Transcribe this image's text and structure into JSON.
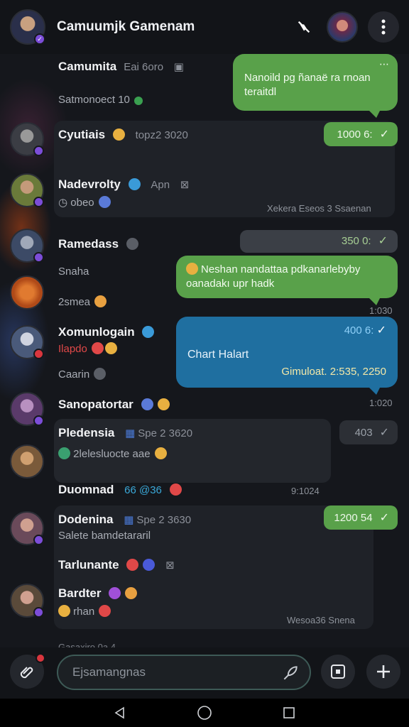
{
  "header": {
    "title": "Camuumjk Gamenam",
    "avatar_color": "#3a3f6a",
    "profile_color": "#8a3a4a"
  },
  "rows": [
    {
      "name": "Camumita",
      "meta": "Eai 6oro",
      "sub": "Satmonoect 10",
      "avatar_color": "#2b2f3a"
    },
    {
      "name": "Cyutiais",
      "meta": "topz2  3020",
      "sub": "",
      "avatar_color": "#3b3d44"
    },
    {
      "name": "Nadevrolty",
      "meta": "Apn",
      "sub": "obeo",
      "avatar_color": "#6a7a3a"
    },
    {
      "name": "Ramedass",
      "meta": "",
      "sub": "Snaha",
      "avatar_color": "#3c4a66"
    },
    {
      "name": "",
      "meta": "",
      "sub": "2smea",
      "avatar_color": "#b04a18"
    },
    {
      "name": "Xomunlogain",
      "meta": "",
      "sub": "Ilapdo",
      "sub2": "Caarin",
      "avatar_color": "#4a5a7a"
    },
    {
      "name": "Sanopatortar",
      "meta": "",
      "sub": "",
      "avatar_color": "#5a3a6a"
    },
    {
      "name": "Pledensia",
      "meta": "Spe 2  3620",
      "sub": "2lelesluocte aae",
      "avatar_color": "#7a5a3a"
    },
    {
      "name": "Duomnad",
      "meta": "66 @36",
      "sub": "",
      "avatar_color": "#3a3a3a"
    },
    {
      "name": "Dodenina",
      "meta": "Spe 2  3630",
      "sub": "Salete bamdetararil",
      "avatar_color": "#6a4a5a"
    },
    {
      "name": "Tarlunante",
      "meta": "",
      "sub": "",
      "avatar_color": "#3a3a3a"
    },
    {
      "name": "Bardter",
      "meta": "",
      "sub": "rhan",
      "avatar_color": "#5a4a3a"
    }
  ],
  "bubbles": {
    "b1": {
      "text": "Nanoild pg ñanaë ra rnoan teraitdl",
      "dots": "⋯"
    },
    "b2": {
      "text": "1000 6:",
      "check": "✓"
    },
    "b3": {
      "text": "Xekera Eseos 3  Ssaenan"
    },
    "b4": {
      "text": "350 0:",
      "check": "✓"
    },
    "b5": {
      "text": "Neshan nandattaa pdkanarlebyby oanadakı upr hadk"
    },
    "b5_time": "1:030",
    "b6": {
      "top": "400 6:",
      "check": "✓",
      "title": "Chart Halart",
      "footer": "Gimuloat. 2:535, 2250"
    },
    "b6_time": "1:020",
    "b7": {
      "text": "403",
      "check": "✓"
    },
    "b8_time": "9:1024",
    "b9": {
      "text": "1200 54",
      "check": "✓"
    },
    "b10": {
      "text": "Wesoa36  Snena"
    },
    "bottom_cut": "Gasaxiro 0a 4"
  },
  "composer": {
    "placeholder": "Ejsamangnas"
  },
  "colors": {
    "green_bubble": "#59a14a",
    "blue_bubble": "#1f6fa0",
    "accent_purple": "#7c4dd8",
    "notification_red": "#d9363e"
  }
}
